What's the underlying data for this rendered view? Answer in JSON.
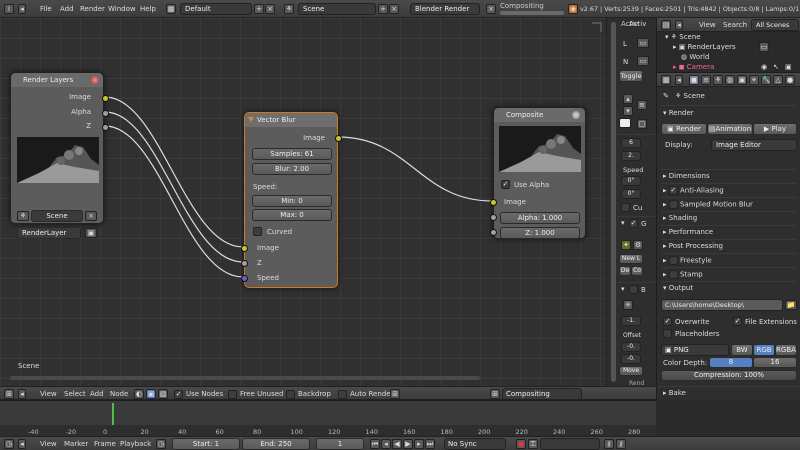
{
  "top_header": {
    "menu": [
      "File",
      "Add",
      "Render",
      "Window",
      "Help"
    ],
    "screen_layout": "Default",
    "scene": "Scene",
    "render_engine": "Blender Render",
    "job_label": "Compositing",
    "stats": "v2.67 | Verts:2539 | Faces:2501 | Tris:4842 | Objects:0/8 | Lamps:0/1 | Mem"
  },
  "node_editor": {
    "scene_label": "Scene",
    "render_layers": {
      "title": "Render Layers",
      "outputs": [
        "Image",
        "Alpha",
        "Z"
      ],
      "scene_value": "Scene",
      "layer_value": "RenderLayer"
    },
    "vector_blur": {
      "title": "Vector Blur",
      "output": "Image",
      "samples": "Samples: 61",
      "blur": "Blur: 2.00",
      "speed_label": "Speed:",
      "min": "Min: 0",
      "max": "Max: 0",
      "curved": "Curved",
      "inputs": [
        "Image",
        "Z",
        "Speed"
      ]
    },
    "composite": {
      "title": "Composite",
      "use_alpha": "Use Alpha",
      "inputs": [
        "Image"
      ],
      "alpha": "Alpha: 1.000",
      "z": "Z: 1.000"
    }
  },
  "node_header": {
    "menu": [
      "View",
      "Select",
      "Add",
      "Node"
    ],
    "use_nodes": "Use Nodes",
    "free_unused": "Free Unused",
    "backdrop": "Backdrop",
    "auto_render": "Auto Render",
    "tree_name": "Compositing"
  },
  "n_panel": {
    "header": "Activ",
    "letters": [
      "L",
      "N"
    ],
    "toggle": "Toggle",
    "speed": "Speed",
    "val6": "6",
    "val2": "2.",
    "deg1": "0°",
    "deg2": "0°",
    "cu": "Cu",
    "new_btn": "New L",
    "de": "De",
    "co": "Co",
    "offset": "Offset",
    "move": "Move",
    "val_neg1": "-1.",
    "val_neg0": "-0.",
    "val_neg0b": "-0.",
    "g_label": "G",
    "b_label": "B",
    "ren": "Rend"
  },
  "outliner": {
    "menu": [
      "View",
      "Search"
    ],
    "filter": "All Scenes",
    "items": [
      "Scene",
      "RenderLayers",
      "World",
      "Camera"
    ]
  },
  "properties": {
    "scene_path": "Scene",
    "render_panel": "Render",
    "render_btn": "Render",
    "animation_btn": "Animation",
    "play_btn": "Play",
    "display_label": "Display:",
    "display_value": "Image Editor",
    "panels": [
      "Dimensions",
      "Anti-Aliasing",
      "Sampled Motion Blur",
      "Shading",
      "Performance",
      "Post Processing",
      "Freestyle",
      "Stamp"
    ],
    "output_label": "Output",
    "output_path": "C:\\Users\\home\\Desktop\\",
    "overwrite": "Overwrite",
    "file_extensions": "File Extensions",
    "placeholders": "Placeholders",
    "format": "PNG",
    "bw": "BW",
    "rgb": "RGB",
    "rgba": "RGBA",
    "color_depth_label": "Color Depth:",
    "depth_8": "8",
    "depth_16": "16",
    "compression": "Compression: 100%",
    "bake": "Bake"
  },
  "timeline": {
    "ticks": [
      "-40",
      "-20",
      "0",
      "20",
      "40",
      "60",
      "80",
      "100",
      "120",
      "140",
      "160",
      "180",
      "200",
      "220",
      "240",
      "260",
      "280"
    ],
    "menu": [
      "View",
      "Marker",
      "Frame",
      "Playback"
    ],
    "start": "Start: 1",
    "end": "End: 250",
    "current": "1",
    "sync": "No Sync"
  }
}
